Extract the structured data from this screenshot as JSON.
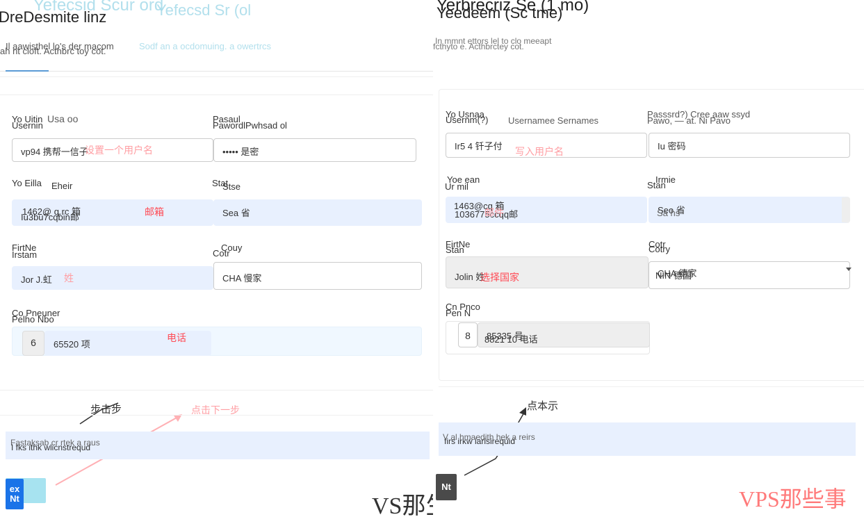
{
  "left": {
    "title_ghost": "Yefecsid Scur ord",
    "title_ghost2": "Yefecsd Sr (ol",
    "title": "DreDesmite linz",
    "subtitle_a": "Il aawisthel  lo's der macom",
    "subtitle_b": "ah nt cloft.  Acthbrc toy cot.",
    "subtitle_ghost": "Sodf an a ocdomuing. a owertrcs",
    "fields": {
      "username": {
        "label_a": "Yo Uitin",
        "label_b": "Usernin",
        "label_ghost": "Usa oo",
        "value": "vp94 携帮一信子",
        "note": "设置一个用户名"
      },
      "password": {
        "label_a": "Pasaul",
        "label_b": "PawordlPwhsad ol",
        "value": "••••• 是密"
      },
      "email": {
        "label_a": "Yo Eilla",
        "label_b": "Eheir",
        "value": "Iu3bu7cqbin邮",
        "value_ghost": "1462@ q.rc 箱",
        "note": "邮箱"
      },
      "state": {
        "label_a": "Stat",
        "label_b": "Stse",
        "value": "Sea 省"
      },
      "firstname": {
        "label_a": "FirtNe",
        "label_b": "Irstam",
        "value": "Jor J.虹",
        "note": "姓"
      },
      "country": {
        "label_a": "Couy",
        "label_b": "Cotr",
        "value": "CHA 慢家"
      },
      "phone": {
        "label_a": "Co Pneuner",
        "label_b": "Pelho Nbo",
        "code": "6",
        "value": "65520 项",
        "note": "电话"
      }
    },
    "step_label": "步击步",
    "next_note": "点击下一步",
    "notice": "I fks ithk wlicnstrequd",
    "notice_ghost": "Fastaksab cr rtek a raus",
    "next_button": "Nt",
    "next_button_top": "ex",
    "watermark": "VS那生"
  },
  "right": {
    "title_a": "Yerbrecriz Se (1 mo)",
    "title_b": "Yeedeem (Sc tme)",
    "subtitle_a": "In mmnt ettors  lel  to clo meeapt",
    "subtitle_b": "fcthyto e.    Acthbrctey cot.",
    "fields": {
      "username": {
        "label_a": "Yo Usnaa",
        "label_b": "Usernm(?)",
        "label_ghost": "Usernamee Sernames",
        "value": "Ir5 4 钎子付",
        "note": "写入用户名"
      },
      "password": {
        "label_a": "Passsrd?) Cree aaw ssyd",
        "label_b": "Pawo, — at. Ni Pavo",
        "value": "Iu 密码"
      },
      "email": {
        "label_a": "Yoe ean",
        "label_b": "Ur mil",
        "value": "1036775ccqq邮",
        "value_ghost": "1463@cq  箱",
        "note": "邮件"
      },
      "state": {
        "label_a": "Irmie",
        "label_b": "Stan",
        "value": "Seo 省",
        "value_ghost": "Sa  hs"
      },
      "firstname": {
        "label_a": "FirtNe",
        "label_b": "Stan",
        "value": "Jolin 姓",
        "note": "选择国家"
      },
      "country": {
        "label_a": "Cotr",
        "label_b": "Cotry",
        "value": "CHA 德家",
        "value_ghost": "NIN 德国"
      },
      "phone": {
        "label_a": "Cn Pnco",
        "label_b": "Pen N",
        "code": "8",
        "value": "85335 号",
        "value_ghost": "8821 10 电话"
      }
    },
    "step_label": "点本示",
    "notice": "firs irkw iarisirequid",
    "notice_ghost": "V al hmaedith hek a reirs",
    "next_button": "Nt",
    "watermark": "VPS那些事"
  },
  "colors": {
    "accent": "#5b9bd5",
    "annotation": "#ff4b55",
    "autofill": "#e8f0fe",
    "button": "#4a4a4a",
    "button_blue": "#1a73e8"
  }
}
